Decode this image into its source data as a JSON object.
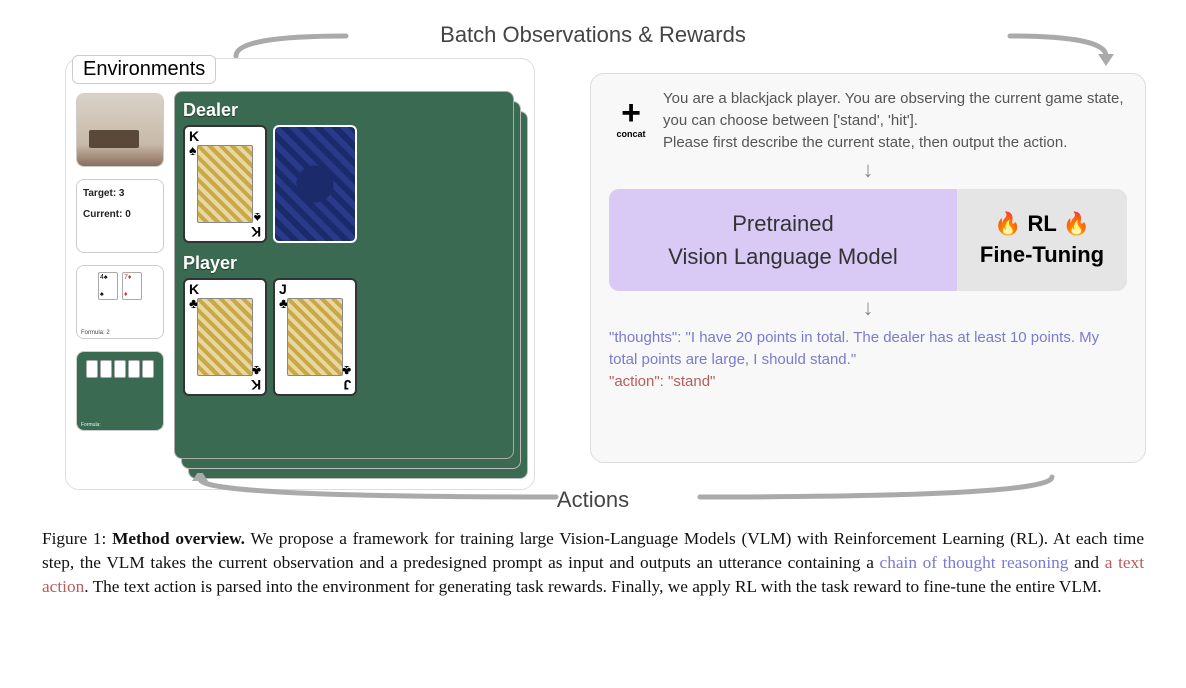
{
  "labels": {
    "top": "Batch Observations & Rewards",
    "bottom": "Actions",
    "environments": "Environments"
  },
  "thumbs": {
    "target_line1": "Target: 3",
    "target_line2": "Current: 0",
    "formula_label": "Formula: 2",
    "green_formula": "Formula:"
  },
  "game": {
    "dealer_label": "Dealer",
    "player_label": "Player",
    "dealer_card_rank": "K",
    "dealer_card_suit": "♠",
    "player_card1_rank": "K",
    "player_card1_suit": "♣",
    "player_card2_rank": "J",
    "player_card2_suit": "♣"
  },
  "concat": {
    "plus": "+",
    "label": "concat"
  },
  "prompt": {
    "line1": "You are a blackjack player. You are observing the current game state, you can choose between ['stand', 'hit'].",
    "line2": "Please first describe the current state, then output the action."
  },
  "model": {
    "vlm_line1": "Pretrained",
    "vlm_line2": "Vision Language Model",
    "rl_line1": "🔥 RL 🔥",
    "rl_line2": "Fine-Tuning"
  },
  "output": {
    "thoughts": "\"thoughts\": \"I have 20 points in total. The dealer has at least 10 points. My total points are large, I should stand.\"",
    "action": "\"action\": \"stand\""
  },
  "caption": {
    "fig_label": "Figure 1:",
    "title": "Method overview.",
    "body_pre": " We propose a framework for training large Vision-Language Models (VLM) with Reinforcement Learning (RL). At each time step, the VLM takes the current observation and a predesigned prompt as input and outputs an utterance containing a ",
    "cot": "chain of thought reasoning",
    "mid": " and ",
    "action_text": "a text action",
    "body_post": ". The text action is parsed into the environment for generating task rewards. Finally, we apply RL with the task reward to fine-tune the entire VLM."
  }
}
